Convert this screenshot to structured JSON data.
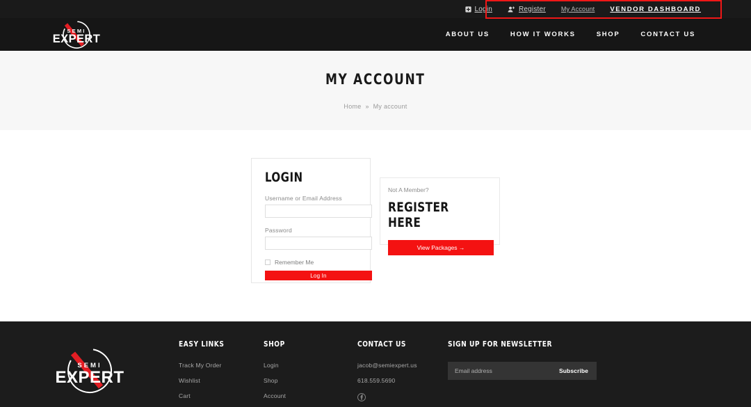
{
  "topbar": {
    "login": "Login",
    "register": "Register",
    "my_account": "My Account",
    "vendor_dashboard": "VENDOR DASHBOARD",
    "login_icon": "login-box-icon",
    "register_icon": "user-plus-icon",
    "highlight_color": "#f01717"
  },
  "brand": {
    "top_word": "SEMI",
    "main_word": "EXPERT",
    "accent_color": "#e31e24"
  },
  "nav": {
    "items": [
      {
        "label": "ABOUT US"
      },
      {
        "label": "HOW IT WORKS"
      },
      {
        "label": "SHOP"
      },
      {
        "label": "CONTACT US"
      }
    ]
  },
  "hero": {
    "title": "MY ACCOUNT",
    "breadcrumb_home": "Home",
    "breadcrumb_sep": "»",
    "breadcrumb_current": "My account"
  },
  "login": {
    "title": "LOGIN",
    "username_label": "Username or Email Address",
    "username_value": "",
    "username_placeholder": "",
    "password_label": "Password",
    "password_value": "",
    "password_placeholder": "",
    "remember_label": "Remember Me",
    "submit_label": "Log In"
  },
  "register": {
    "subtitle": "Not A Member?",
    "title": "REGISTER HERE",
    "button_label": "View Packages →"
  },
  "footer": {
    "easy_links": {
      "heading": "EASY LINKS",
      "items": [
        {
          "label": "Track My Order"
        },
        {
          "label": "Wishlist"
        },
        {
          "label": "Cart"
        }
      ]
    },
    "shop": {
      "heading": "SHOP",
      "items": [
        {
          "label": "Login"
        },
        {
          "label": "Shop"
        },
        {
          "label": "Account"
        }
      ]
    },
    "contact": {
      "heading": "CONTACT US",
      "email": "jacob@semiexpert.us",
      "phone": "618.559.5690",
      "social_icon": "facebook-icon"
    },
    "newsletter": {
      "heading": "SIGN UP FOR NEWSLETTER",
      "email_value": "",
      "email_placeholder": "Email address",
      "subscribe_label": "Subscribe"
    }
  }
}
